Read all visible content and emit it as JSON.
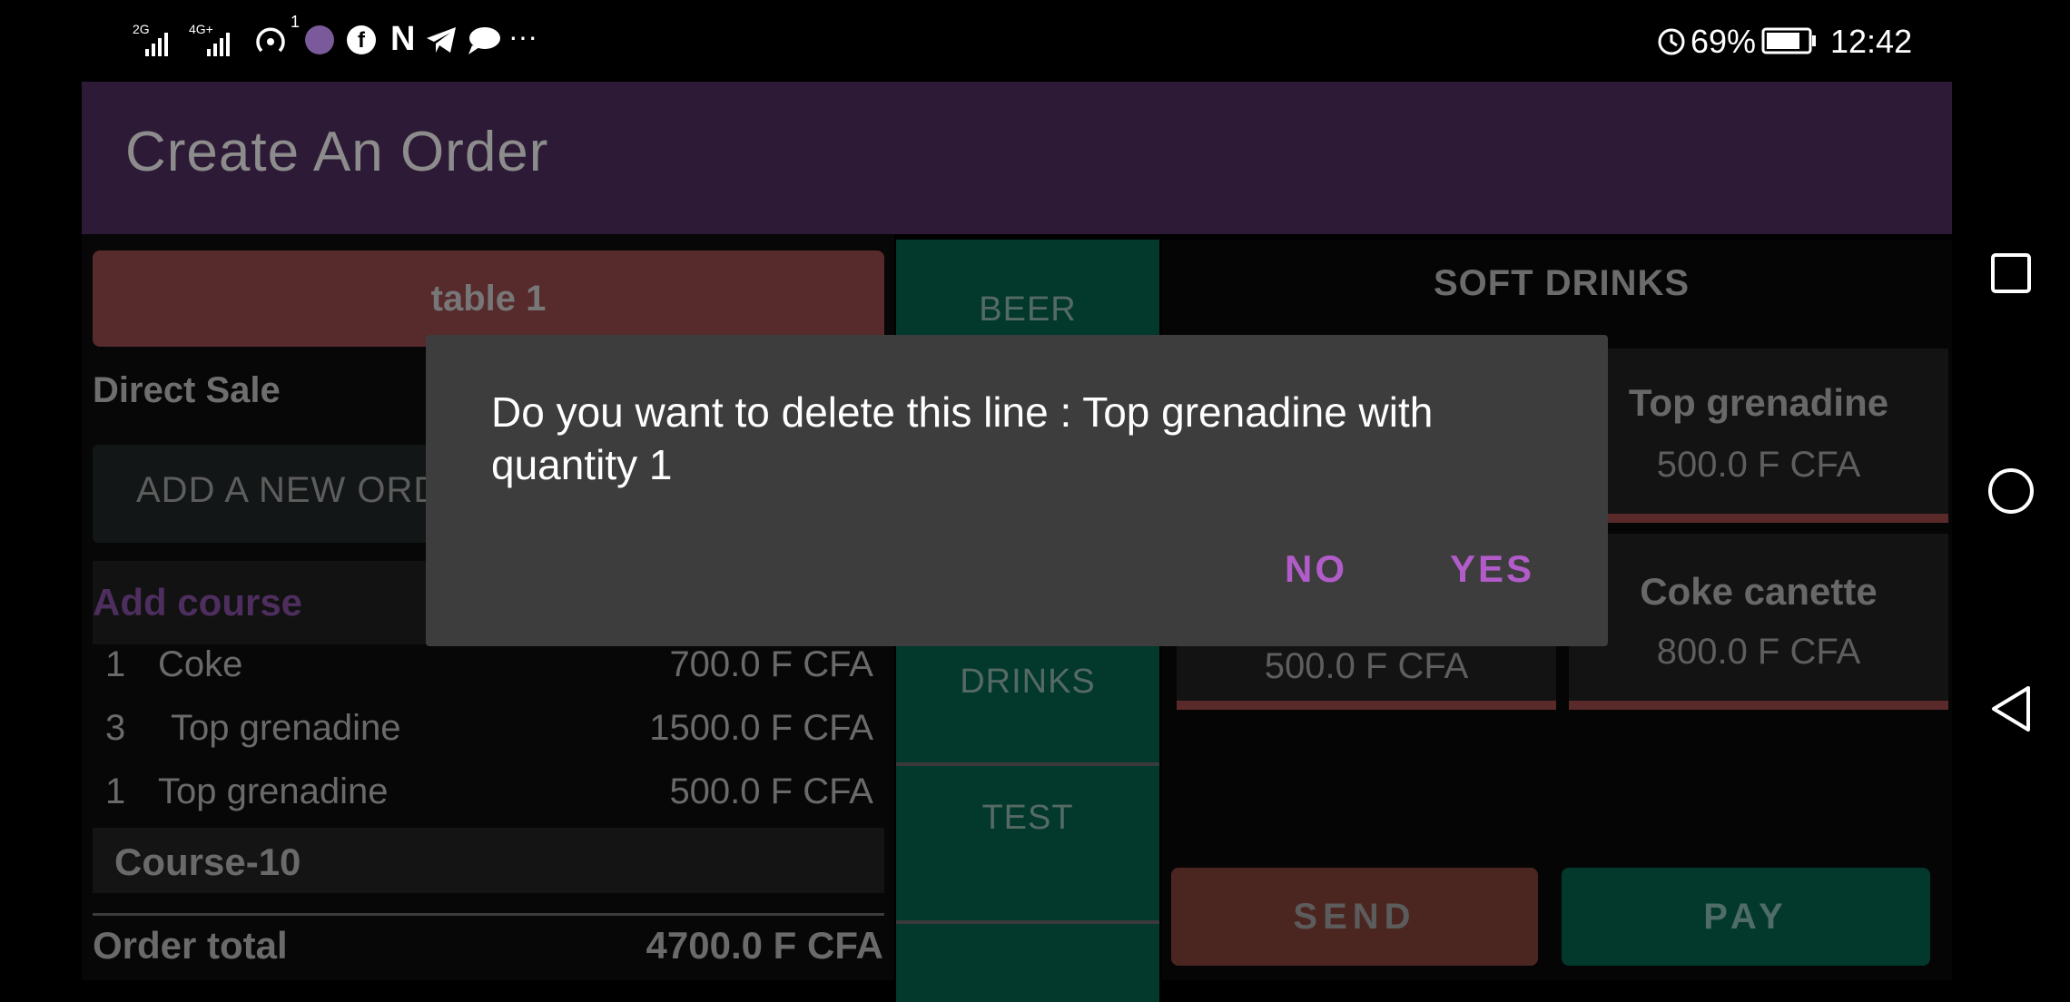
{
  "status_bar": {
    "network1": "2G",
    "network2": "4G+",
    "hotspot_count": "1",
    "more": "···",
    "battery": "69%",
    "time": "12:42"
  },
  "app_bar": {
    "title": "Create An Order"
  },
  "order": {
    "table_label": "table 1",
    "direct_sale": "Direct Sale",
    "add_order_label": "ADD A NEW ORD",
    "add_course_label": "Add course",
    "lines": [
      {
        "qty": "1",
        "name": "Coke",
        "price": "700.0 F CFA"
      },
      {
        "qty": "3",
        "name": "Top grenadine",
        "price": "1500.0 F CFA"
      },
      {
        "qty": "1",
        "name": "Top grenadine",
        "price": "500.0 F CFA"
      }
    ],
    "course_label": "Course-10",
    "total_label": "Order total",
    "total_value": "4700.0 F CFA"
  },
  "categories": [
    "BEER",
    "DRINKS",
    "TEST"
  ],
  "products": {
    "category_title": "SOFT DRINKS",
    "items": [
      {
        "name": "Top grenadine",
        "price": "500.0 F CFA"
      },
      {
        "name": "Coke canette",
        "price": "800.0 F CFA"
      }
    ],
    "partial_price": "500.0 F CFA"
  },
  "actions": {
    "send": "SEND",
    "pay": "PAY"
  },
  "dialog": {
    "message": "Do you want to delete this line : Top grenadine with quantity 1",
    "no": "NO",
    "yes": "YES"
  },
  "colors": {
    "app_bar": "#2d1a36",
    "table_button": "#572a2c",
    "category": "#03382d",
    "dialog_bg": "#3d3d3d",
    "dialog_accent": "#b15cc9"
  }
}
